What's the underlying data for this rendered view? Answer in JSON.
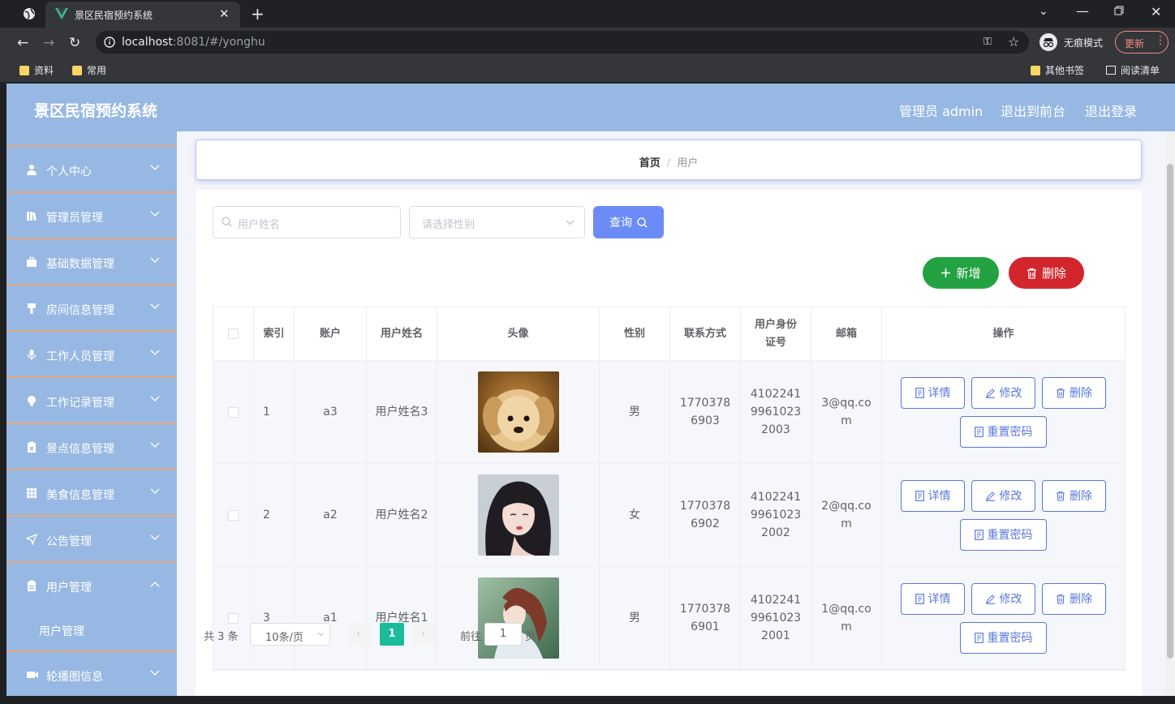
{
  "browser": {
    "tab_title": "景区民宿预约系统",
    "url_host": "localhost",
    "url_rest": ":8081/#/yonghu",
    "incognito_label": "无痕模式",
    "update_label": "更新",
    "bookmarks": [
      "资料",
      "常用"
    ],
    "other_bookmarks": "其他书签",
    "reading_list": "阅读清单"
  },
  "header": {
    "brand": "景区民宿预约系统",
    "admin_label": "管理员 admin",
    "to_front": "退出到前台",
    "logout": "退出登录"
  },
  "sidebar": {
    "items": [
      {
        "label": "个人中心",
        "icon": "user-icon"
      },
      {
        "label": "管理员管理",
        "icon": "book-icon"
      },
      {
        "label": "基础数据管理",
        "icon": "briefcase-icon"
      },
      {
        "label": "房间信息管理",
        "icon": "brush-icon"
      },
      {
        "label": "工作人员管理",
        "icon": "microphone-icon"
      },
      {
        "label": "工作记录管理",
        "icon": "bulb-icon"
      },
      {
        "label": "景点信息管理",
        "icon": "clipboard-x-icon"
      },
      {
        "label": "美食信息管理",
        "icon": "grid-icon"
      },
      {
        "label": "公告管理",
        "icon": "send-icon"
      },
      {
        "label": "用户管理",
        "icon": "clipboard-icon"
      },
      {
        "label": "轮播图信息",
        "icon": "video-icon"
      }
    ],
    "submenu_label": "用户管理"
  },
  "breadcrumb": {
    "home": "首页",
    "current": "用户"
  },
  "search": {
    "name_placeholder": "用户姓名",
    "gender_placeholder": "请选择性别",
    "query_label": "查询"
  },
  "actions": {
    "add_label": "新增",
    "delete_label": "删除"
  },
  "table": {
    "headers": [
      "索引",
      "账户",
      "用户姓名",
      "头像",
      "性别",
      "联系方式",
      "用户身份证号",
      "邮箱",
      "操作"
    ],
    "rows": [
      {
        "index": "1",
        "account": "a3",
        "name": "用户姓名3",
        "gender": "男",
        "phone": "17703786903",
        "id_card": "410224199610232003",
        "email": "3@qq.com"
      },
      {
        "index": "2",
        "account": "a2",
        "name": "用户姓名2",
        "gender": "女",
        "phone": "17703786902",
        "id_card": "410224199610232002",
        "email": "2@qq.com"
      },
      {
        "index": "3",
        "account": "a1",
        "name": "用户姓名1",
        "gender": "男",
        "phone": "17703786901",
        "id_card": "410224199610232001",
        "email": "1@qq.com"
      }
    ],
    "op_labels": {
      "detail": "详情",
      "edit": "修改",
      "delete": "删除",
      "reset": "重置密码"
    }
  },
  "pager": {
    "total": "共 3 条",
    "page_size": "10条/页",
    "current_page": "1",
    "goto_prefix": "前往",
    "goto_value": "1",
    "goto_suffix": "页"
  },
  "colors": {
    "header_bg": "#97b8e2",
    "menu_separator": "#e4a983",
    "primary": "#6b8cf7",
    "add": "#23a241",
    "delete": "#d3262c",
    "pager_active": "#1abc9c"
  }
}
